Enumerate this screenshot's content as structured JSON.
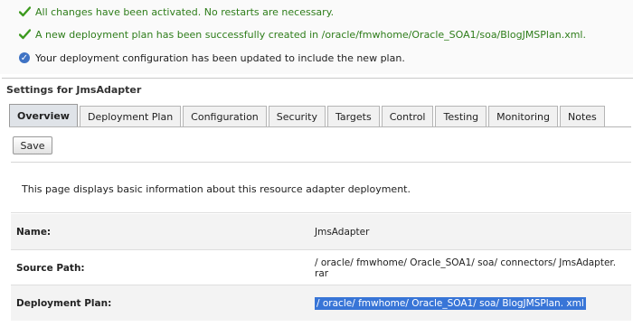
{
  "messages": [
    {
      "icon": "checkmark-icon",
      "text": "All changes have been activated. No restarts are necessary."
    },
    {
      "icon": "checkmark-icon",
      "text": "A new deployment plan has been successfully created in /oracle/fmwhome/Oracle_SOA1/soa/BlogJMSPlan.xml."
    },
    {
      "icon": "info-icon",
      "text": "Your deployment configuration has been updated to include the new plan."
    }
  ],
  "panel": {
    "title": "Settings for JmsAdapter",
    "tabs": [
      {
        "label": "Overview",
        "active": true
      },
      {
        "label": "Deployment Plan"
      },
      {
        "label": "Configuration"
      },
      {
        "label": "Security"
      },
      {
        "label": "Targets"
      },
      {
        "label": "Control"
      },
      {
        "label": "Testing"
      },
      {
        "label": "Monitoring"
      },
      {
        "label": "Notes"
      }
    ],
    "save_label": "Save",
    "description": "This page displays basic information about this resource adapter deployment.",
    "fields": [
      {
        "label": "Name:",
        "value": "JmsAdapter"
      },
      {
        "label": "Source Path:",
        "value": "/ oracle/ fmwhome/ Oracle_SOA1/ soa/ connectors/ JmsAdapter. rar"
      },
      {
        "label": "Deployment Plan:",
        "value": "/ oracle/ fmwhome/ Oracle_SOA1/ soa/ BlogJMSPlan. xml",
        "selected": true
      }
    ]
  },
  "colors": {
    "success_text": "#2e7d1a",
    "active_tab_bg": "#dfe3e8",
    "selection_bg": "#3875d7"
  }
}
